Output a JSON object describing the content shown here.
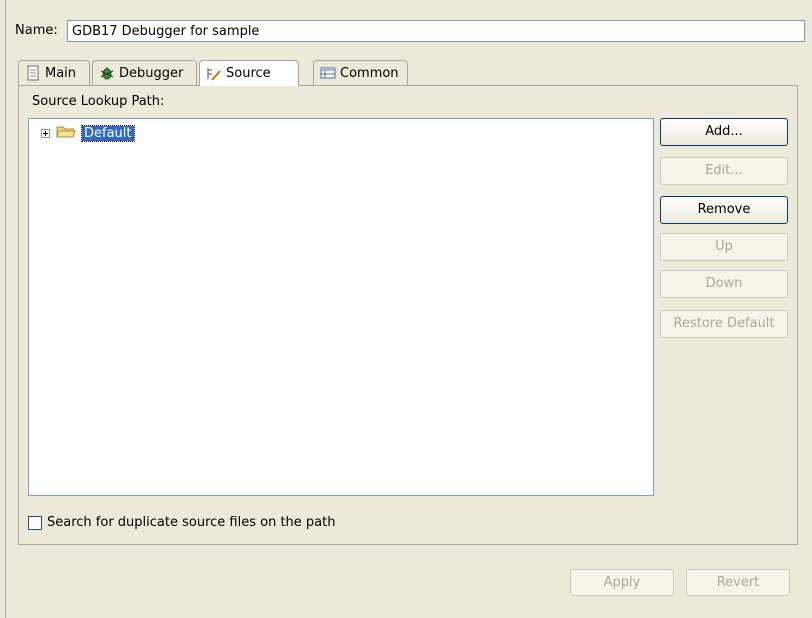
{
  "name_field": {
    "label": "Name:",
    "value": "GDB17 Debugger for sample"
  },
  "tabs": [
    {
      "label": "Main",
      "icon": "document-icon"
    },
    {
      "label": "Debugger",
      "icon": "bug-icon"
    },
    {
      "label": "Source",
      "icon": "source-icon",
      "active": true
    },
    {
      "label": "Common",
      "icon": "table-icon"
    }
  ],
  "source": {
    "lookup_label": "Source Lookup Path:",
    "tree_items": [
      {
        "label": "Default",
        "expanded": false,
        "selected": true
      }
    ],
    "buttons": {
      "add": "Add...",
      "edit": "Edit...",
      "remove": "Remove",
      "up": "Up",
      "down": "Down",
      "restore": "Restore Default"
    },
    "duplicate_checkbox_label": "Search for duplicate source files on the path",
    "duplicate_checked": false
  },
  "footer": {
    "apply": "Apply",
    "revert": "Revert"
  },
  "colors": {
    "selection": "#316ac5",
    "background": "#ece9d8"
  }
}
